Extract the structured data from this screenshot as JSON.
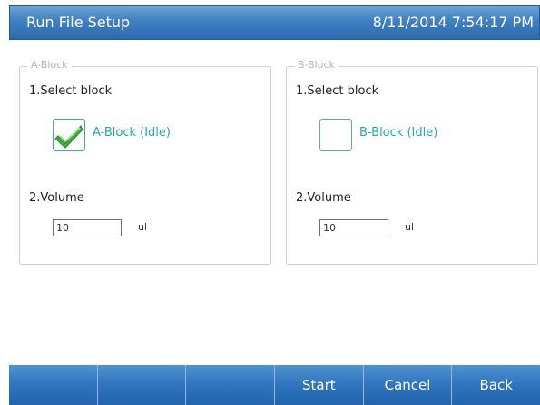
{
  "window": {
    "title": "Run File Setup",
    "datetime": "8/11/2014 7:54:17 PM"
  },
  "block_a": {
    "legend": "A-Block",
    "step1_label": "1.Select block",
    "checked": true,
    "block_label": "A-Block (Idle)",
    "step2_label": "2.Volume",
    "volume_value": "10",
    "unit": "ul"
  },
  "block_b": {
    "legend": "B-Block",
    "step1_label": "1.Select block",
    "checked": false,
    "block_label": "B-Block (Idle)",
    "step2_label": "2.Volume",
    "volume_value": "10",
    "unit": "ul"
  },
  "bottom_bar": {
    "buttons": [
      {
        "label": ""
      },
      {
        "label": ""
      },
      {
        "label": ""
      },
      {
        "label": "Start"
      },
      {
        "label": "Cancel"
      },
      {
        "label": "Back"
      }
    ]
  },
  "colors": {
    "accent_teal": "#2aa6a6",
    "check_green": "#3fae3a",
    "header_blue": "#3f7fc0"
  },
  "icons": {
    "checked_icon": "checkmark-icon"
  }
}
